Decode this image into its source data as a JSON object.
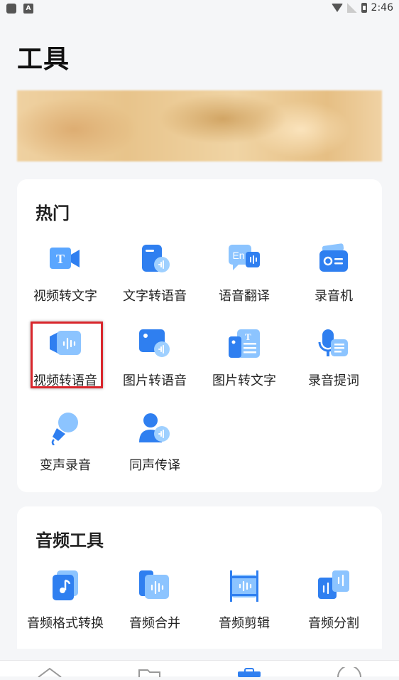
{
  "status_bar": {
    "time": "2:46",
    "notification_badge": "A"
  },
  "page_title": "工具",
  "hot": {
    "title": "热门",
    "tools": [
      {
        "label": "视频转文字",
        "icon": "video-to-text-icon"
      },
      {
        "label": "文字转语音",
        "icon": "text-to-speech-icon"
      },
      {
        "label": "语音翻译",
        "icon": "voice-translate-icon"
      },
      {
        "label": "录音机",
        "icon": "recorder-icon"
      },
      {
        "label": "视频转语音",
        "icon": "video-to-audio-icon"
      },
      {
        "label": "图片转语音",
        "icon": "image-to-speech-icon"
      },
      {
        "label": "图片转文字",
        "icon": "image-to-text-icon"
      },
      {
        "label": "录音提词",
        "icon": "teleprompter-icon"
      },
      {
        "label": "变声录音",
        "icon": "voice-changer-icon"
      },
      {
        "label": "同声传译",
        "icon": "simultaneous-interpretation-icon"
      }
    ]
  },
  "audio_tools": {
    "title": "音频工具",
    "tools": [
      {
        "label": "音频格式转换",
        "icon": "audio-format-convert-icon"
      },
      {
        "label": "音频合并",
        "icon": "audio-merge-icon"
      },
      {
        "label": "音频剪辑",
        "icon": "audio-trim-icon"
      },
      {
        "label": "音频分割",
        "icon": "audio-split-icon"
      }
    ]
  },
  "colors": {
    "accent_blue": "#2f7ff0",
    "light_blue": "#8cc4ff",
    "highlight_red": "#d9262c"
  }
}
